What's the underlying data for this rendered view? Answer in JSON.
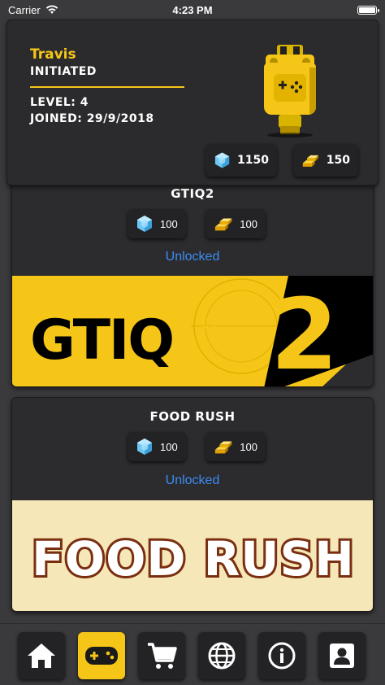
{
  "status_bar": {
    "carrier": "Carrier",
    "time": "4:23 PM"
  },
  "profile": {
    "name": "Travis",
    "rank": "INITIATED",
    "level_text": "LEVEL: 4",
    "joined_text": "JOINED: 29/9/2018",
    "gems": "1150",
    "gold": "150"
  },
  "games": [
    {
      "title": "GTIQ2",
      "gem_price": "100",
      "gold_price": "100",
      "status": "Unlocked",
      "banner_text": "GTIQ",
      "banner_number": "2"
    },
    {
      "title": "FOOD RUSH",
      "gem_price": "100",
      "gold_price": "100",
      "status": "Unlocked",
      "banner_text": "FOOD RUSH"
    }
  ],
  "tab_bar": {
    "items": [
      {
        "icon": "home-icon",
        "active": false
      },
      {
        "icon": "gamepad-icon",
        "active": true
      },
      {
        "icon": "cart-icon",
        "active": false
      },
      {
        "icon": "globe-icon",
        "active": false
      },
      {
        "icon": "info-icon",
        "active": false
      },
      {
        "icon": "profile-icon",
        "active": false
      }
    ]
  },
  "colors": {
    "accent": "#f5c518",
    "link": "#3b8cf5",
    "background": "#3a3a3c",
    "card": "#2c2c2e",
    "food_banner_bg": "#f6e7b8",
    "food_banner_text": "#7a2e10"
  }
}
